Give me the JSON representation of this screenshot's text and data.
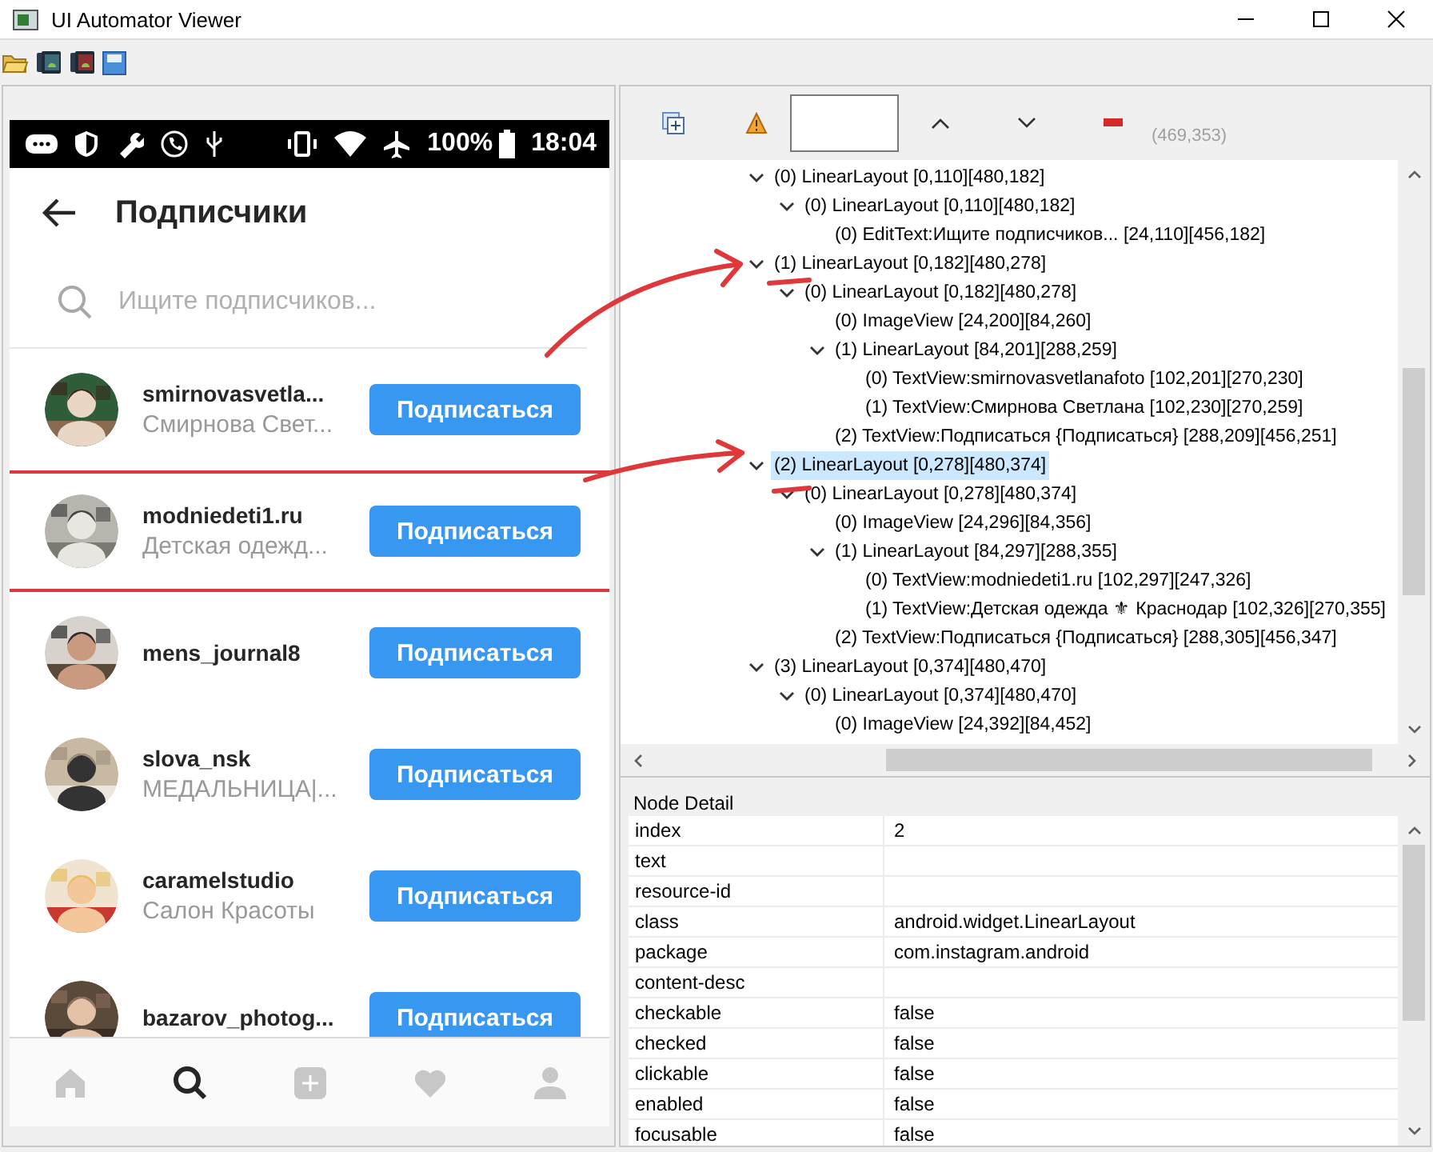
{
  "window": {
    "title": "UI Automator Viewer"
  },
  "device": {
    "status_bar": {
      "battery": "100%",
      "time": "18:04"
    },
    "header": {
      "title": "Подписчики"
    },
    "search": {
      "placeholder": "Ищите подписчиков..."
    },
    "followers": [
      {
        "username": "smirnovasvetla...",
        "name": "Смирнова Свет...",
        "button": "Подписаться",
        "selected": false
      },
      {
        "username": "modniedeti1.ru",
        "name": "Детская одежд...",
        "button": "Подписаться",
        "selected": true
      },
      {
        "username": "mens_journal8",
        "button": "Подписаться",
        "selected": false
      },
      {
        "username": "slova_nsk",
        "name": "МЕДАЛЬНИЦА|...",
        "button": "Подписаться",
        "selected": false
      },
      {
        "username": "caramelstudio",
        "name": "Салон Красоты",
        "button": "Подписаться",
        "selected": false
      },
      {
        "username": "bazarov_photog...",
        "button": "Подписаться",
        "selected": false
      }
    ],
    "nav": [
      {
        "kind": "home",
        "selected": false
      },
      {
        "kind": "search",
        "selected": true
      },
      {
        "kind": "add",
        "selected": false
      },
      {
        "kind": "heart",
        "selected": false
      },
      {
        "kind": "profile",
        "selected": false
      }
    ]
  },
  "hierarchy": {
    "coordinates": "(469,353)",
    "nodes": [
      {
        "label": "(0) LinearLayout [0,110][480,182]",
        "expanded": true,
        "selected": false,
        "children": [
          {
            "label": "(0) LinearLayout [0,110][480,182]",
            "expanded": true,
            "selected": false,
            "children": [
              {
                "label": "(0) EditText:Ищите подписчиков... [24,110][456,182]",
                "selected": false
              }
            ]
          }
        ]
      },
      {
        "label": "(1) LinearLayout [0,182][480,278]",
        "expanded": true,
        "selected": false,
        "children": [
          {
            "label": "(0) LinearLayout [0,182][480,278]",
            "expanded": true,
            "selected": false,
            "children": [
              {
                "label": "(0) ImageView [24,200][84,260]",
                "selected": false
              },
              {
                "label": "(1) LinearLayout [84,201][288,259]",
                "expanded": true,
                "selected": false,
                "children": [
                  {
                    "label": "(0) TextView:smirnovasvetlanafoto [102,201][270,230]",
                    "selected": false
                  },
                  {
                    "label": "(1) TextView:Смирнова Светлана [102,230][270,259]",
                    "selected": false
                  }
                ]
              },
              {
                "label": "(2) TextView:Подписаться {Подписаться} [288,209][456,251]",
                "selected": false
              }
            ]
          }
        ]
      },
      {
        "label": "(2) LinearLayout [0,278][480,374]",
        "expanded": true,
        "selected": true,
        "children": [
          {
            "label": "(0) LinearLayout [0,278][480,374]",
            "expanded": true,
            "selected": false,
            "children": [
              {
                "label": "(0) ImageView [24,296][84,356]",
                "selected": false
              },
              {
                "label": "(1) LinearLayout [84,297][288,355]",
                "expanded": true,
                "selected": false,
                "children": [
                  {
                    "label": "(0) TextView:modniedeti1.ru [102,297][247,326]",
                    "selected": false
                  },
                  {
                    "label": "(1) TextView:Детская одежда ⚜ Краснодар [102,326][270,355]",
                    "selected": false
                  }
                ]
              },
              {
                "label": "(2) TextView:Подписаться {Подписаться} [288,305][456,347]",
                "selected": false
              }
            ]
          }
        ]
      },
      {
        "label": "(3) LinearLayout [0,374][480,470]",
        "expanded": true,
        "selected": false,
        "children": [
          {
            "label": "(0) LinearLayout [0,374][480,470]",
            "expanded": true,
            "selected": false,
            "children": [
              {
                "label": "(0) ImageView [24,392][84,452]",
                "selected": false
              }
            ]
          }
        ]
      }
    ]
  },
  "node_detail": {
    "title": "Node Detail",
    "rows": [
      {
        "key": "index",
        "value": "2"
      },
      {
        "key": "text"
      },
      {
        "key": "resource-id"
      },
      {
        "key": "class",
        "value": "android.widget.LinearLayout"
      },
      {
        "key": "package",
        "value": "com.instagram.android"
      },
      {
        "key": "content-desc"
      },
      {
        "key": "checkable",
        "value": "false"
      },
      {
        "key": "checked",
        "value": "false"
      },
      {
        "key": "clickable",
        "value": "false"
      },
      {
        "key": "enabled",
        "value": "false"
      },
      {
        "key": "focusable",
        "value": "false"
      }
    ]
  },
  "annotations": [
    {
      "kind": "arrow"
    },
    {
      "kind": "underline"
    },
    {
      "kind": "arrow"
    },
    {
      "kind": "underline"
    }
  ]
}
